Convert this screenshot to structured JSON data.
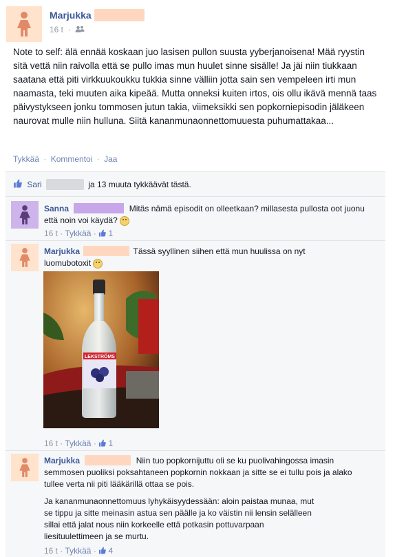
{
  "post": {
    "author": "Marjukka",
    "time": "16 t",
    "audience_icon": "friends-icon",
    "text": "Note to self: älä ennää koskaan juo lasisen pullon suusta yyberjanoisena! Mää ryystin sitä vettä niin raivolla että se pullo imas mun huulet sinne sisälle! Ja jäi niin tiukkaan saatana että piti virkkuukoukku tukkia sinne välliin jotta sain sen vempeleen irti mun naamasta, teki muuten aika kipeää. Mutta onneksi kuiten irtos, ois ollu ikävä mennä taas päivystykseen jonku tommosen jutun takia, viimeksikki sen popkorniepisodin jäläkeen naurovat mulle niin hulluna. Siitä kananmunaonnettomuuesta puhumattakaa...",
    "actions": {
      "like": "Tykkää",
      "comment": "Kommentoi",
      "share": "Jaa",
      "sep": "·"
    }
  },
  "likes": {
    "liker": "Sari",
    "rest": "ja 13 muuta tykkäävät tästä."
  },
  "comments": [
    {
      "author": "Sanna",
      "text": "Mitäs nämä episodit on olleetkaan? millasesta pullosta oot juonu että noin voi käydä?",
      "time": "16 t",
      "like": "Tykkää",
      "like_count": "1"
    },
    {
      "author": "Marjukka",
      "text": "Tässä syyllinen siihen että mun huulissa on nyt luomubotoxit",
      "photo_label": "LEKSTRÖMS",
      "time": "16 t",
      "like": "Tykkää",
      "like_count": "1"
    },
    {
      "author": "Marjukka",
      "text_p1": "Niin tuo popkornijuttu oli se ku puolivahingossa imasin semmosen puoliksi poksahtaneen popkornin nokkaan ja sitte se ei tullu pois ja alako tullee verta nii piti lääkärillä ottaa se pois.",
      "text_p2": "Ja kananmunaonnettomuus lyhykäisyydessään: aloin paistaa munaa, mut se tippu ja sitte meinasin astua sen päälle ja ko väistin nii lensin selälleen sillai että jalat nous niin korkeelle että potkasin pottuvarpaan liesituulettimeen ja se murtu.",
      "time": "16 t",
      "like": "Tykkää",
      "like_count": "4"
    }
  ],
  "colors": {
    "link": "#3b5998",
    "meta": "#9197a3",
    "peach": "#ffe3cc",
    "purple": "#cdb4ea",
    "panel": "#f6f7f9"
  }
}
